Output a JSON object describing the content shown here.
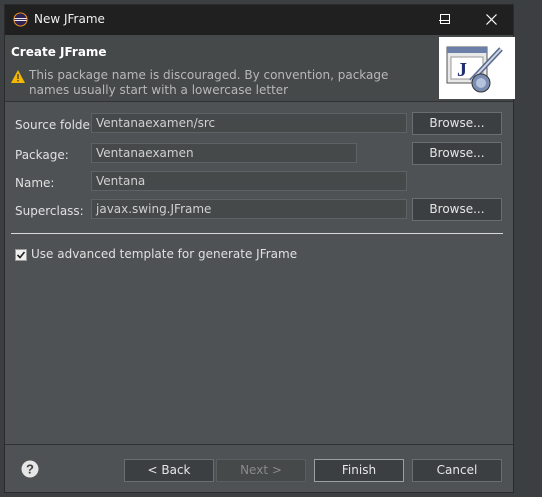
{
  "window": {
    "title": "New JFrame",
    "controls": [
      "minimize-icon",
      "maximize-icon",
      "close-icon"
    ]
  },
  "header": {
    "title": "Create JFrame",
    "message": "This package name is discouraged. By convention, package names usually start with a lowercase letter",
    "wizard_image": "java-file-pen-icon"
  },
  "form": {
    "source_folder": {
      "label": "Source folder:",
      "value": "Ventanaexamen/src",
      "browse": "Browse..."
    },
    "package": {
      "label": "Package:",
      "value": "Ventanaexamen",
      "browse": "Browse..."
    },
    "name": {
      "label": "Name:",
      "value": "Ventana"
    },
    "superclass": {
      "label": "Superclass:",
      "value": "javax.swing.JFrame",
      "browse": "Browse..."
    },
    "advanced_template": {
      "label": "Use advanced template for generate JFrame",
      "checked": true
    }
  },
  "buttons": {
    "back": "< Back",
    "next": "Next >",
    "finish": "Finish",
    "cancel": "Cancel"
  },
  "colors": {
    "dialog_bg": "#4e5254",
    "header_bg": "#45494a",
    "titlebar_bg": "#202020",
    "warning": "#f5b800"
  }
}
